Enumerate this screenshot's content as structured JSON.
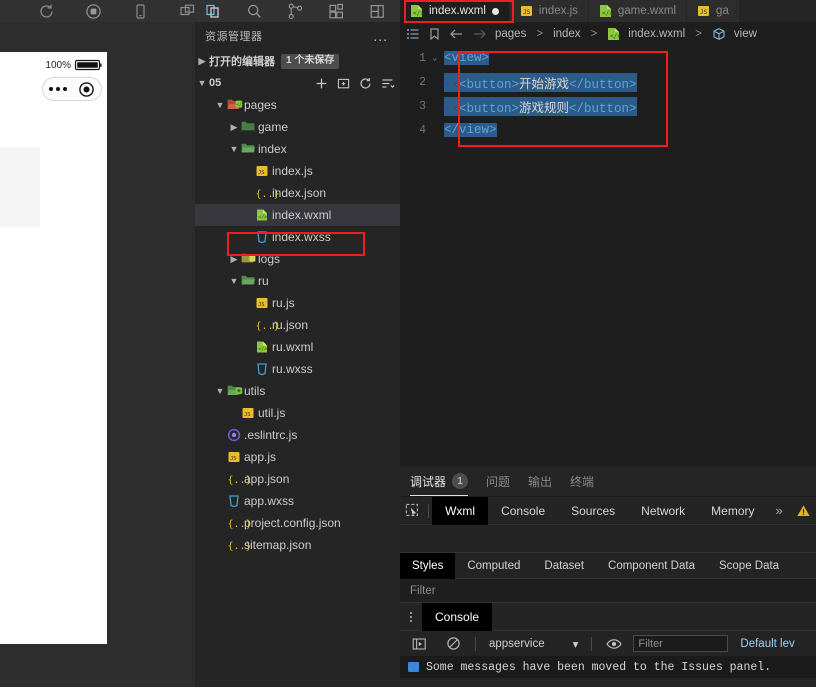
{
  "toolbar": {
    "left_icons": [
      {
        "name": "compile-refresh-icon",
        "label": "编译"
      },
      {
        "name": "record-stop-icon",
        "label": "真机调试"
      },
      {
        "name": "preview-phone-icon",
        "label": "预览"
      },
      {
        "name": "split-window-icon",
        "label": "切后台"
      }
    ],
    "activity_icons": [
      {
        "name": "explorer-icon",
        "label": "资源管理器"
      },
      {
        "name": "search-icon",
        "label": "搜索"
      },
      {
        "name": "source-control-icon",
        "label": "源代码管理"
      },
      {
        "name": "extensions-icon",
        "label": "扩展"
      },
      {
        "name": "layout-icon",
        "label": "布局"
      },
      {
        "name": "docker-icon",
        "label": "Docker"
      }
    ]
  },
  "tabs": [
    {
      "label": "index.wxml",
      "icon": "wxml-file-icon",
      "active": true,
      "dirty": true
    },
    {
      "label": "index.js",
      "icon": "js-file-icon",
      "active": false,
      "dirty": false
    },
    {
      "label": "game.wxml",
      "icon": "wxml-file-icon",
      "active": false,
      "dirty": false
    },
    {
      "label": "ga",
      "icon": "js-file-icon",
      "active": false,
      "dirty": false
    }
  ],
  "breadcrumb": {
    "icons": [
      "outline-list-icon",
      "bookmark-icon",
      "back-arrow-icon",
      "forward-arrow-icon"
    ],
    "path": [
      "pages",
      "index",
      "index.wxml",
      "view"
    ],
    "separator": ">",
    "file_icon": "wxml-file-icon",
    "symbol_icon": "cube-symbol-icon"
  },
  "simulator": {
    "battery_percent": "100%",
    "battery_icon": "battery-full-icon",
    "capsule_menu_icon": "more-dots-icon",
    "capsule_close_icon": "target-circle-icon"
  },
  "explorer": {
    "title": "资源管理器",
    "more_label": "...",
    "open_editors": {
      "label": "打开的编辑器",
      "badge": "1 个未保存"
    },
    "project": {
      "label": "05",
      "actions": [
        "new-file-icon",
        "new-folder-icon",
        "refresh-icon",
        "collapse-all-icon"
      ]
    },
    "tree": [
      {
        "label": "pages",
        "icon": "folder-open-wxml-icon",
        "kind": "folder",
        "depth": 1,
        "expanded": true
      },
      {
        "label": "game",
        "icon": "folder-icon",
        "kind": "folder",
        "depth": 2,
        "expanded": false
      },
      {
        "label": "index",
        "icon": "folder-open-icon",
        "kind": "folder",
        "depth": 2,
        "expanded": true
      },
      {
        "label": "index.js",
        "icon": "js-file-icon",
        "kind": "file",
        "depth": 3
      },
      {
        "label": "index.json",
        "icon": "json-file-icon",
        "kind": "file",
        "depth": 3
      },
      {
        "label": "index.wxml",
        "icon": "wxml-file-icon",
        "kind": "file",
        "depth": 3,
        "selected": true
      },
      {
        "label": "index.wxss",
        "icon": "wxss-file-icon",
        "kind": "file",
        "depth": 3
      },
      {
        "label": "logs",
        "icon": "folder-yellow-icon",
        "kind": "folder",
        "depth": 2,
        "expanded": false
      },
      {
        "label": "ru",
        "icon": "folder-open-icon",
        "kind": "folder",
        "depth": 2,
        "expanded": true
      },
      {
        "label": "ru.js",
        "icon": "js-file-icon",
        "kind": "file",
        "depth": 3
      },
      {
        "label": "ru.json",
        "icon": "json-file-icon",
        "kind": "file",
        "depth": 3
      },
      {
        "label": "ru.wxml",
        "icon": "wxml-file-icon",
        "kind": "file",
        "depth": 3
      },
      {
        "label": "ru.wxss",
        "icon": "wxss-file-icon",
        "kind": "file",
        "depth": 3
      },
      {
        "label": "utils",
        "icon": "folder-open-green-icon",
        "kind": "folder",
        "depth": 1,
        "expanded": true
      },
      {
        "label": "util.js",
        "icon": "js-file-icon",
        "kind": "file",
        "depth": 2
      },
      {
        "label": ".eslintrc.js",
        "icon": "eslint-file-icon",
        "kind": "file",
        "depth": 1
      },
      {
        "label": "app.js",
        "icon": "js-file-icon",
        "kind": "file",
        "depth": 1
      },
      {
        "label": "app.json",
        "icon": "json-file-icon",
        "kind": "file",
        "depth": 1
      },
      {
        "label": "app.wxss",
        "icon": "wxss-file-icon",
        "kind": "file",
        "depth": 1
      },
      {
        "label": "project.config.json",
        "icon": "json-file-icon",
        "kind": "file",
        "depth": 1
      },
      {
        "label": "sitemap.json",
        "icon": "json-file-icon",
        "kind": "file",
        "depth": 1
      }
    ]
  },
  "editor": {
    "lines": [
      {
        "number": "1",
        "fold": "v",
        "indent": "",
        "text": "<view>",
        "selected": true
      },
      {
        "number": "2",
        "fold": "",
        "indent": "··",
        "text": "<button>开始游戏</button>",
        "selected": true
      },
      {
        "number": "3",
        "fold": "",
        "indent": "··",
        "text": "<button>游戏规则</button>",
        "selected": true
      },
      {
        "number": "4",
        "fold": "",
        "indent": "",
        "text": "</view>",
        "selected": true
      }
    ]
  },
  "panel": {
    "tabs": [
      {
        "label": "调试器",
        "badge": "1",
        "active": true
      },
      {
        "label": "问题",
        "badge": "",
        "active": false
      },
      {
        "label": "输出",
        "badge": "",
        "active": false
      },
      {
        "label": "终端",
        "badge": "",
        "active": false
      }
    ],
    "devtools": {
      "inspect_icon": "inspect-cursor-icon",
      "tabs": [
        "Wxml",
        "Console",
        "Sources",
        "Network",
        "Memory"
      ],
      "active_tab": "Wxml",
      "more_label": "»",
      "warning_icon": "warning-triangle-icon"
    },
    "styles": {
      "tabs": [
        "Styles",
        "Computed",
        "Dataset",
        "Component Data",
        "Scope Data"
      ],
      "active_tab": "Styles",
      "filter_placeholder": "Filter"
    },
    "console": {
      "title": "Console",
      "kebab_icon": "kebab-menu-icon",
      "sidebar_icon": "console-sidebar-icon",
      "clear_icon": "clear-console-icon",
      "context": "appservice",
      "eye_icon": "eye-icon",
      "filter_placeholder": "Filter",
      "level_label": "Default lev",
      "message": "Some messages have been moved to the Issues panel."
    }
  },
  "colors": {
    "accent_red": "#f01e1e",
    "selection_blue": "#2e5c8a",
    "tag_blue": "#5aa4d8",
    "editor_bg": "#1e1e1e",
    "sidebar_bg": "#252526",
    "chrome_bg": "#2d2d2d"
  }
}
